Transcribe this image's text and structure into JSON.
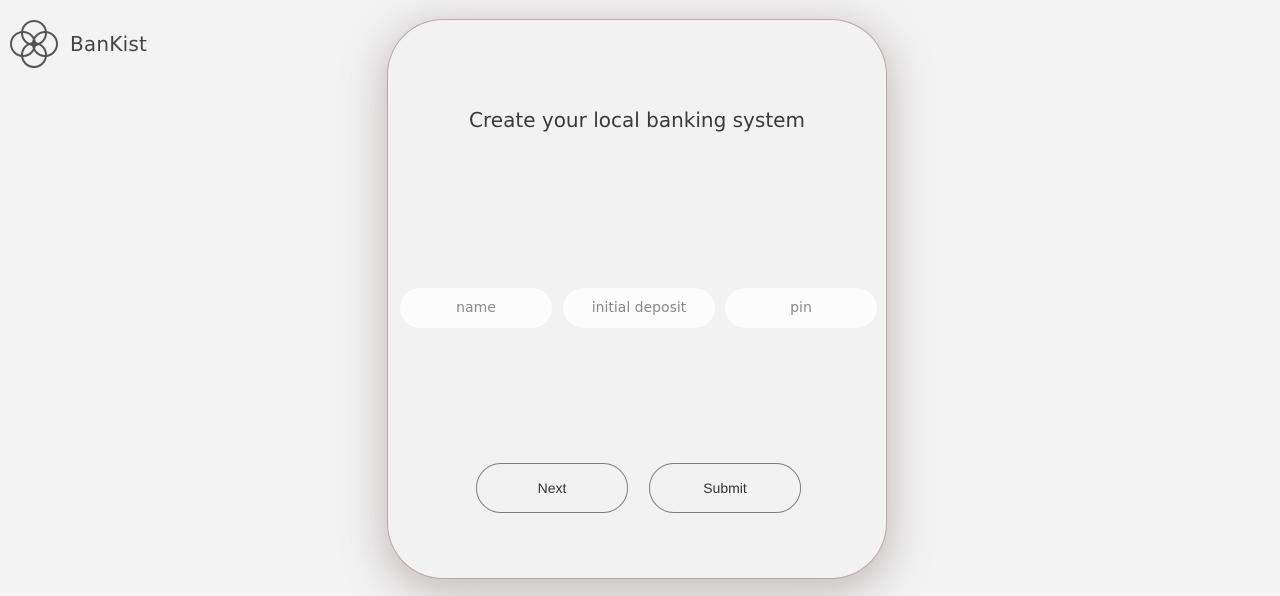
{
  "brand": {
    "name": "BanKist",
    "icon": "four-circle-logo-icon"
  },
  "card": {
    "title": "Create your local banking system",
    "fields": {
      "name_placeholder": "name",
      "deposit_placeholder": "initial deposit",
      "pin_placeholder": "pin",
      "name_value": "",
      "deposit_value": "",
      "pin_value": ""
    },
    "buttons": {
      "next_label": "Next",
      "submit_label": "Submit"
    }
  },
  "colors": {
    "background": "#f3f3f3",
    "card_background": "#f2f2f2",
    "input_background": "#fcfcfc",
    "text": "#3a3a3a"
  }
}
